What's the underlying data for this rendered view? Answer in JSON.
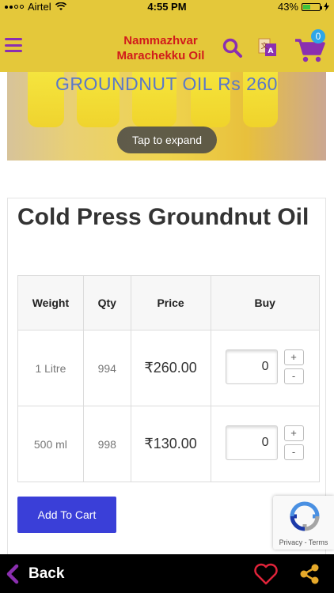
{
  "status_bar": {
    "carrier": "Airtel",
    "time": "4:55 PM",
    "battery": "43%",
    "battery_level": 0.43
  },
  "header": {
    "brand_line1": "Nammazhvar",
    "brand_line2": "Marachekku Oil",
    "cart_count": "0",
    "icons": [
      "menu-icon",
      "search-icon",
      "translate-icon",
      "cart-icon"
    ],
    "colors": {
      "bar": "#e4c83a",
      "icons": "#8b2fb0",
      "brand": "#d11b1b",
      "badge": "#2ea6e8"
    }
  },
  "banner": {
    "caption": "GROUNDNUT OIL Rs 260",
    "tap_label": "Tap to expand"
  },
  "product": {
    "title": "Cold Press Groundnut Oil",
    "columns": [
      "Weight",
      "Qty",
      "Price",
      "Buy"
    ],
    "rows": [
      {
        "weight": "1 Litre",
        "qty": "994",
        "price": "₹260.00",
        "buy_qty": "0"
      },
      {
        "weight": "500 ml",
        "qty": "998",
        "price": "₹130.00",
        "buy_qty": "0"
      }
    ],
    "plus_label": "+",
    "minus_label": "-",
    "add_to_cart": "Add To Cart"
  },
  "recaptcha": {
    "links": "Privacy - Terms"
  },
  "bottom_bar": {
    "back_label": "Back",
    "icons": [
      "back-chevron-icon",
      "heart-icon",
      "share-icon"
    ],
    "accent": "#8b2fb0"
  }
}
